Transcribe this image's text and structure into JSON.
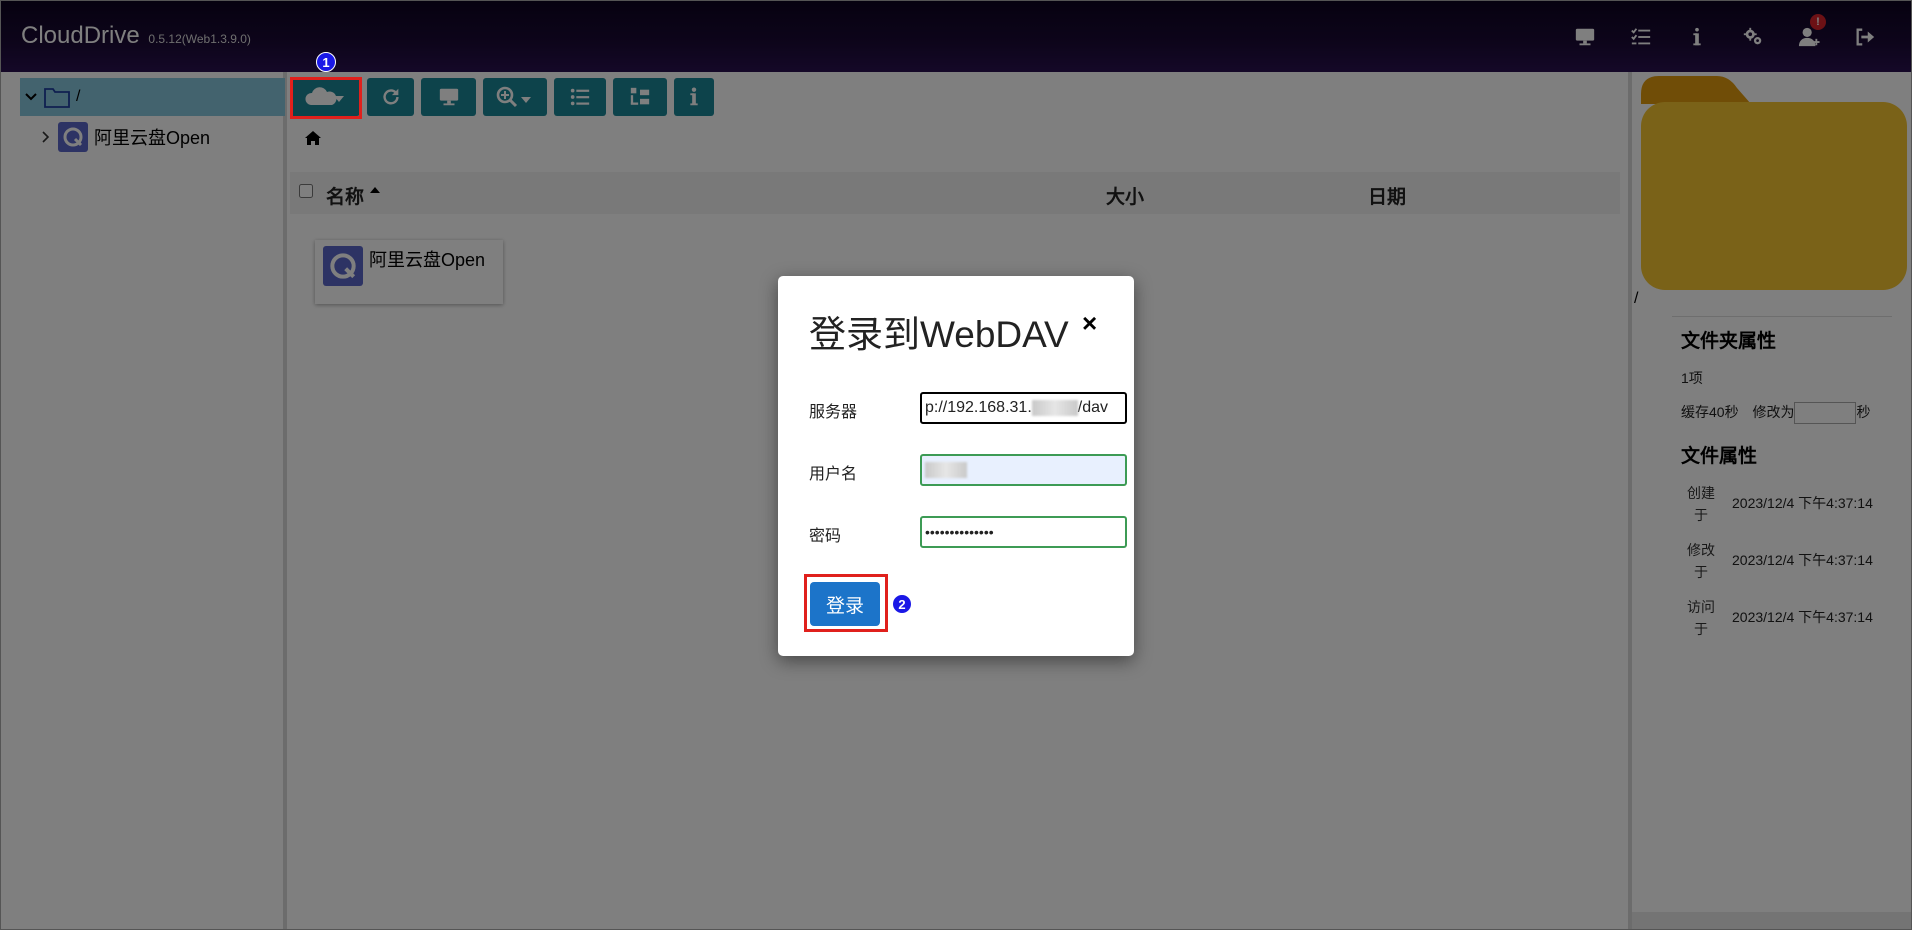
{
  "app": {
    "title": "CloudDrive",
    "version": "0.5.12(Web1.3.9.0)"
  },
  "topbar": {
    "icons": [
      "monitor-icon",
      "task-list-icon",
      "info-icon",
      "gears-icon",
      "user-alert-icon",
      "logout-icon"
    ],
    "notification_badge": "!"
  },
  "sidebar": {
    "root_label": "/",
    "items": [
      {
        "label": "阿里云盘Open"
      }
    ]
  },
  "toolbar": {
    "buttons": [
      "cloud-add-dropdown",
      "refresh",
      "monitor",
      "search-zoom-dropdown",
      "list-view",
      "tree-view",
      "info"
    ]
  },
  "file_list": {
    "columns": {
      "name": "名称",
      "size": "大小",
      "date": "日期"
    },
    "items": [
      {
        "name": "阿里云盘Open"
      }
    ]
  },
  "right_panel": {
    "path": "/",
    "folder_props_title": "文件夹属性",
    "item_count": "1项",
    "cache_label": "缓存40秒",
    "modify_label": "修改为",
    "sec_unit": "秒",
    "file_props_title": "文件属性",
    "created_label": "创建于",
    "created_value": "2023/12/4 下午4:37:14",
    "modified_label": "修改于",
    "modified_value": "2023/12/4 下午4:37:14",
    "accessed_label": "访问于",
    "accessed_value": "2023/12/4 下午4:37:14"
  },
  "modal": {
    "title": "登录到WebDAV",
    "close": "×",
    "server_label": "服务器",
    "server_value": "p://192.168.31.",
    "server_suffix": "/dav",
    "username_label": "用户名",
    "password_label": "密码",
    "password_value": "••••••••••••••",
    "login_button": "登录"
  },
  "annotations": {
    "step1": "1",
    "step2": "2"
  },
  "colors": {
    "topbar": "#1b0a36",
    "toolbar_button": "#1b8796",
    "tree_selected": "#86c7dd",
    "login_button": "#1c74c9",
    "highlight": "#e0201c",
    "step_marker": "#1a18e6",
    "folder": "#f4c430"
  }
}
